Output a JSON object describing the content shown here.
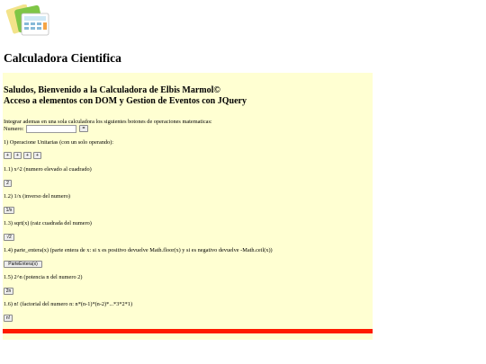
{
  "header": {
    "title": "Calculadora Cientifica",
    "logo_icon": "calculator-folder-icon"
  },
  "panel": {
    "welcome_line1": "Saludos, Bienvenido a la Calculadora de Elbis Marmol©",
    "welcome_line2": "Acceso a elementos con DOM y Gestion de Eventos con JQuery",
    "intro": "Integrar ademas en una sola calculadora los siguientes botones de operaciones matematicas:",
    "numero_label": "Numero:",
    "numero_value": "",
    "equals_label": "=",
    "section1": "1) Operacione Unitarias (con un solo operando):",
    "plus_buttons": [
      "+",
      "+",
      "+",
      "+"
    ],
    "op1": {
      "desc": "1.1) x^2 (numero elevado al cuadrado)",
      "btn": "2"
    },
    "op2": {
      "desc": "1.2) 1/x (inverso del numero)",
      "btn": "1/x"
    },
    "op3": {
      "desc": "1.3) sqrt(x) (raiz cuadrada del numero)",
      "btn": "√2"
    },
    "op4": {
      "desc": "1.4) parte_entera(x) (parte entera de x: si x es positivo devuelve Math.floor(x) y si es negativo devuelve -Math.ceil(x))",
      "btn": "ParteEntera(x)"
    },
    "op5": {
      "desc": "1.5) 2^n (potencia n del numero 2)",
      "btn": "2n"
    },
    "op6": {
      "desc": "1.6) n! (factorial del numero n: n*(n-1)*(n-2)*...*3*2*1)",
      "btn": "n!"
    }
  },
  "colors": {
    "panel_bg": "#ffffd2",
    "divider": "#ff1a00"
  }
}
